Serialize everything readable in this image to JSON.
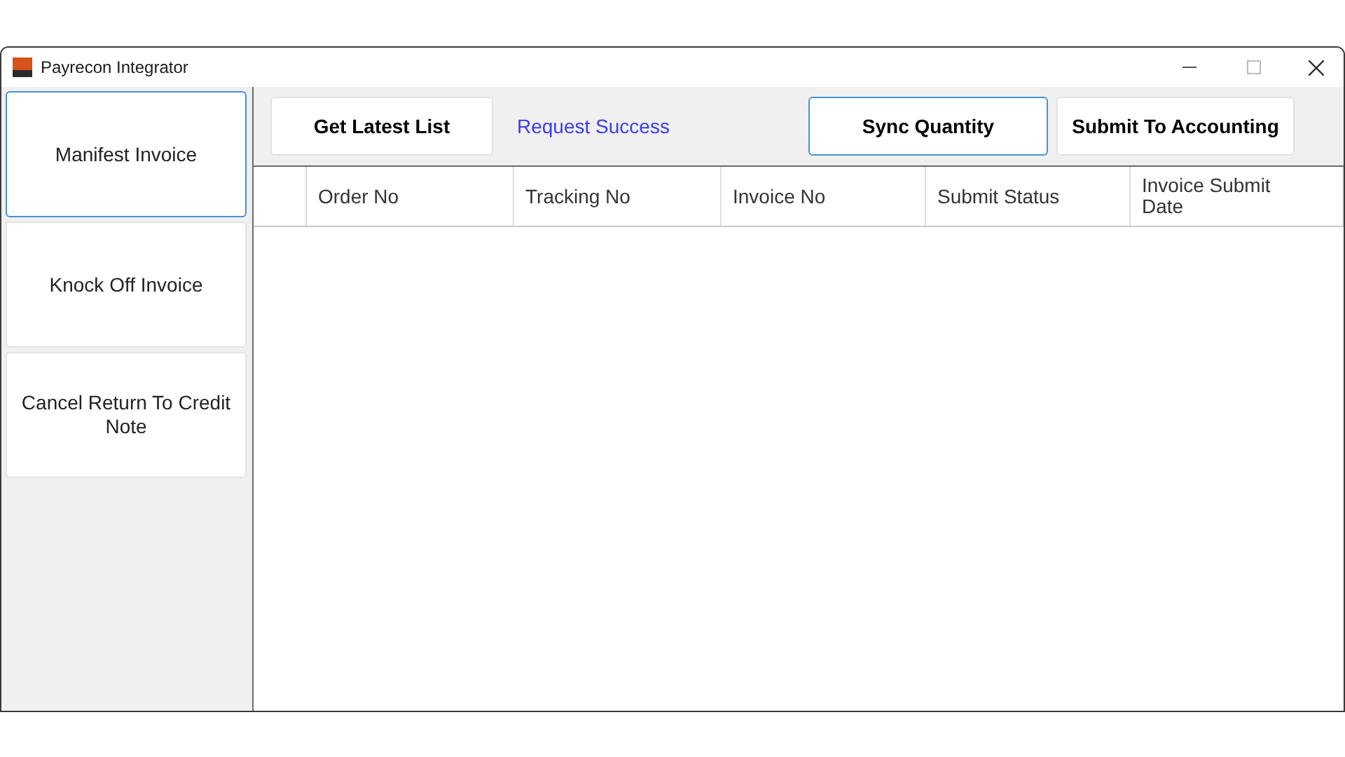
{
  "window": {
    "title": "Payrecon Integrator"
  },
  "sidebar": {
    "items": [
      {
        "label": "Manifest Invoice",
        "selected": true
      },
      {
        "label": "Knock Off Invoice",
        "selected": false
      },
      {
        "label": "Cancel Return To Credit Note",
        "selected": false
      }
    ]
  },
  "toolbar": {
    "buttons": [
      {
        "label": "Get Latest List",
        "focused": false
      },
      {
        "label": "Sync Quantity",
        "focused": true
      },
      {
        "label": "Submit To Accounting",
        "focused": false
      }
    ],
    "status": "Request Success"
  },
  "table": {
    "columns": [
      "Order No",
      "Tracking No",
      "Invoice No",
      "Submit Status",
      "Invoice Submit Date"
    ]
  }
}
